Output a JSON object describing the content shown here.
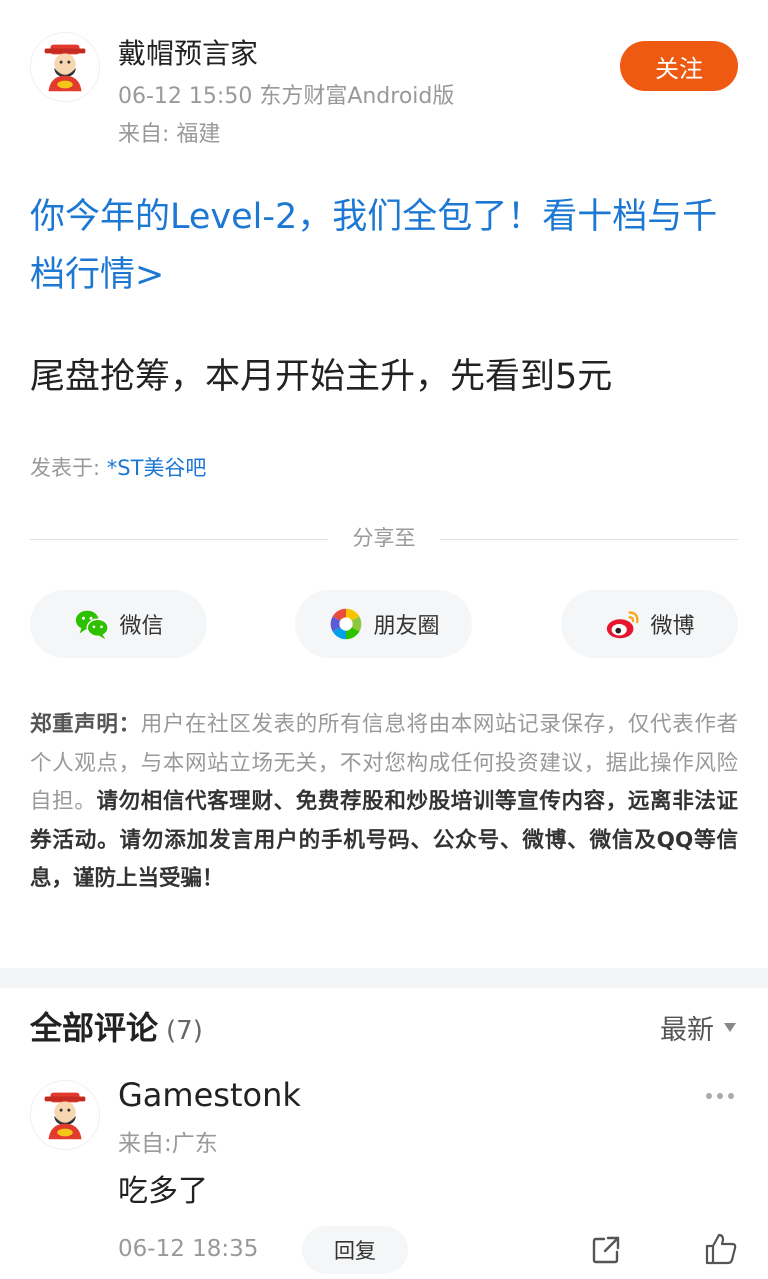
{
  "post": {
    "author": "戴帽预言家",
    "meta": "06-12 15:50 东方财富Android版",
    "from": "来自: 福建",
    "follow_label": "关注",
    "promo_link": "你今年的Level-2，我们全包了！看十档与千档行情>",
    "body": "尾盘抢筹，本月开始主升，先看到5元",
    "posted_in_label": "发表于:",
    "forum": "*ST美谷吧"
  },
  "share": {
    "label": "分享至",
    "wechat": "微信",
    "moments": "朋友圈",
    "weibo": "微博"
  },
  "disclaimer": {
    "heading": "郑重声明：",
    "normal": "用户在社区发表的所有信息将由本网站记录保存，仅代表作者个人观点，与本网站立场无关，不对您构成任何投资建议，据此操作风险自担。",
    "bold": "请勿相信代客理财、免费荐股和炒股培训等宣传内容，远离非法证券活动。请勿添加发言用户的手机号码、公众号、微博、微信及QQ等信息，谨防上当受骗！"
  },
  "comments": {
    "title": "全部评论",
    "count": "(7)",
    "sort": "最新",
    "items": [
      {
        "user": "Gamestonk",
        "from": "来自:广东",
        "text": "吃多了",
        "time": "06-12 18:35",
        "reply_label": "回复"
      }
    ]
  },
  "colors": {
    "accent": "#ee5a12",
    "link": "#1c78d3"
  }
}
